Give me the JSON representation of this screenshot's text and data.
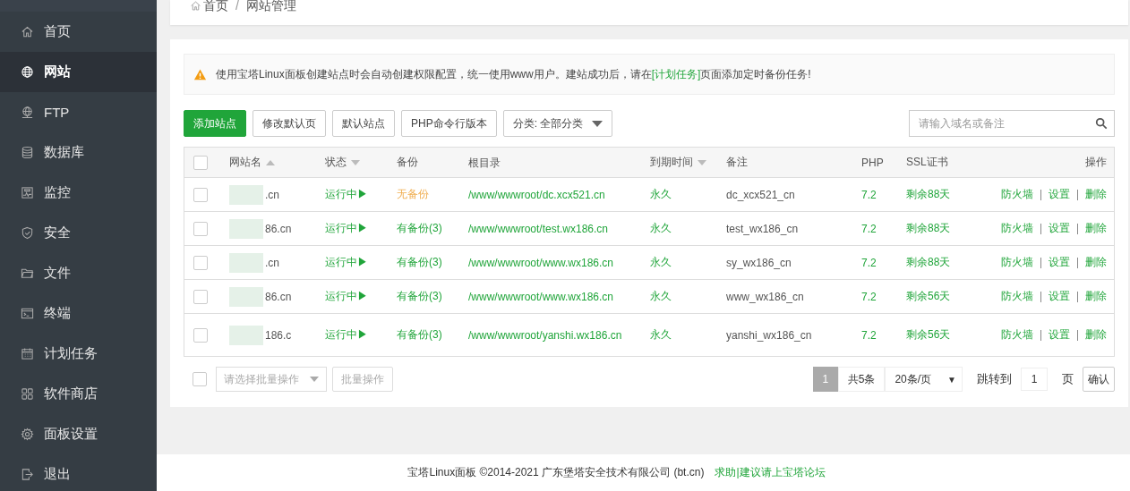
{
  "sidebar": {
    "items": [
      {
        "label": "首页",
        "selected": false
      },
      {
        "label": "网站",
        "selected": true
      },
      {
        "label": "FTP",
        "selected": false
      },
      {
        "label": "数据库",
        "selected": false
      },
      {
        "label": "监控",
        "selected": false
      },
      {
        "label": "安全",
        "selected": false
      },
      {
        "label": "文件",
        "selected": false
      },
      {
        "label": "终端",
        "selected": false
      },
      {
        "label": "计划任务",
        "selected": false
      },
      {
        "label": "软件商店",
        "selected": false
      },
      {
        "label": "面板设置",
        "selected": false
      },
      {
        "label": "退出",
        "selected": false
      }
    ]
  },
  "breadcrumb": {
    "items": [
      "首页",
      "网站管理"
    ],
    "separator": "/"
  },
  "alert": {
    "text_before": "使用宝塔Linux面板创建站点时会自动创建权限配置，统一使用www用户。建站成功后，请在",
    "link": "[计划任务]",
    "text_after": "页面添加定时备份任务!"
  },
  "toolbar": {
    "buttons": [
      {
        "label": "添加站点",
        "kind": "primary"
      },
      {
        "label": "修改默认页",
        "kind": "default"
      },
      {
        "label": "默认站点",
        "kind": "default"
      },
      {
        "label": "PHP命令行版本",
        "kind": "default"
      }
    ],
    "category": "分类: 全部分类",
    "search": {
      "placeholder": "请输入域名或备注"
    }
  },
  "table": {
    "select_all": {
      "checked": false
    },
    "columns": [
      {
        "label": "网站名",
        "sorted": true,
        "ascending": true
      },
      {
        "label": "状态",
        "sorted": true,
        "ascending": false
      },
      {
        "label": "备份",
        "sorted": false
      },
      {
        "label": "根目录",
        "sorted": false
      },
      {
        "label": "到期时间",
        "sorted": true,
        "ascending": false
      },
      {
        "label": "备注",
        "sorted": false
      },
      {
        "label": "PHP",
        "sorted": false
      },
      {
        "label": "SSL证书",
        "sorted": false
      },
      {
        "label": "操作",
        "sorted": false
      }
    ],
    "rows": [
      {
        "checked": false,
        "name": ".cn",
        "status": "运行中▶",
        "backup": {
          "text": "无备份",
          "kind": "none"
        },
        "root": "/www/wwwroot/dc.xcx521.cn",
        "expire": "永久",
        "remark": "dc_xcx521_cn",
        "php": "7.2",
        "ssl": "剩余88天",
        "actions": [
          "防火墙",
          "设置",
          "删除"
        ]
      },
      {
        "checked": false,
        "name": "86.cn",
        "status": "运行中▶",
        "backup": {
          "text": "有备份(3)",
          "kind": "has"
        },
        "root": "/www/wwwroot/test.wx186.cn",
        "expire": "永久",
        "remark": "test_wx186_cn",
        "php": "7.2",
        "ssl": "剩余88天",
        "actions": [
          "防火墙",
          "设置",
          "删除"
        ]
      },
      {
        "checked": false,
        "name": ".cn",
        "status": "运行中▶",
        "backup": {
          "text": "有备份(3)",
          "kind": "has"
        },
        "root": "/www/wwwroot/www.wx186.cn",
        "expire": "永久",
        "remark": "sy_wx186_cn",
        "php": "7.2",
        "ssl": "剩余88天",
        "actions": [
          "防火墙",
          "设置",
          "删除"
        ]
      },
      {
        "checked": false,
        "name": "86.cn",
        "status": "运行中▶",
        "backup": {
          "text": "有备份(3)",
          "kind": "has"
        },
        "root": "/www/wwwroot/www.wx186.cn",
        "expire": "永久",
        "remark": "www_wx186_cn",
        "php": "7.2",
        "ssl": "剩余56天",
        "actions": [
          "防火墙",
          "设置",
          "删除"
        ]
      },
      {
        "checked": false,
        "name": "186.c",
        "status": "运行中▶",
        "backup": {
          "text": "有备份(3)",
          "kind": "has"
        },
        "root": "/www/wwwroot/yanshi.wx186.cn",
        "expire": "永久",
        "remark": "yanshi_wx186_cn",
        "php": "7.2",
        "ssl": "剩余56天",
        "actions": [
          "防火墙",
          "设置",
          "删除"
        ]
      }
    ]
  },
  "batch": {
    "checked": false,
    "placeholder": "请选择批量操作",
    "button": "批量操作",
    "button_disabled": true
  },
  "pagination": {
    "current": "1",
    "total": "共5条",
    "per_page": "20条/页",
    "per_page_caret": "▼",
    "jump_label": "跳转到",
    "jump_value": "1",
    "unit": "页",
    "confirm": "确认"
  },
  "footer": {
    "text": "宝塔Linux面板 ©2014-2021 广东堡塔安全技术有限公司 (bt.cn)",
    "link": "求助|建议请上宝塔论坛"
  }
}
